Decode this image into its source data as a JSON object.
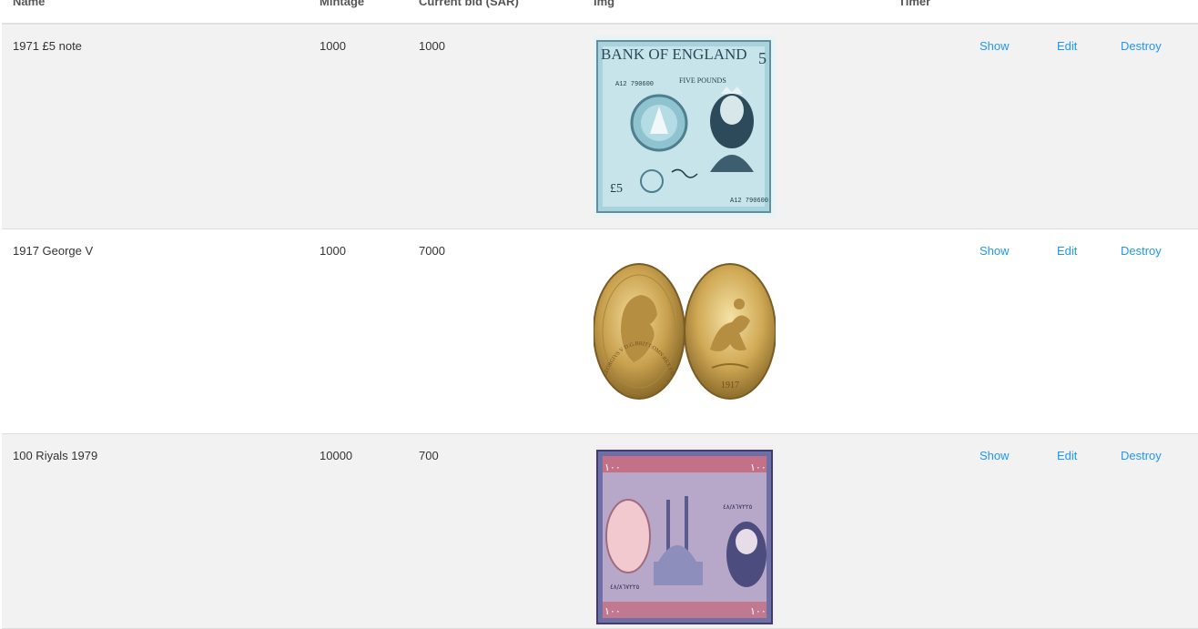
{
  "columns": {
    "name": "Name",
    "mintage": "Mintage",
    "current_bid": "Current bid (SAR)",
    "img": "Img",
    "timer": "Timer"
  },
  "rows": [
    {
      "name": "1971 £5 note",
      "mintage": "1000",
      "current_bid": "1000",
      "img_subject": "five-pound-banknote-image",
      "img_text": {
        "bank": "BANK OF ENGLAND",
        "serial": "A12 790600",
        "denom": "FIVE POUNDS",
        "symbol": "£5",
        "corner": "5"
      },
      "show": "Show",
      "edit": "Edit",
      "destroy": "Destroy"
    },
    {
      "name": "1917 George V",
      "mintage": "1000",
      "current_bid": "7000",
      "img_subject": "gold-sovereign-coin-image",
      "img_text": {
        "legend": "GEORGIVS V D.G.BRITT:OMN:REX F.D.IND:IMP:",
        "year": "1917"
      },
      "show": "Show",
      "edit": "Edit",
      "destroy": "Destroy"
    },
    {
      "name": "100 Riyals 1979",
      "mintage": "10000",
      "current_bid": "700",
      "img_subject": "hundred-riyal-banknote-image",
      "img_text": {
        "corner": "١٠٠",
        "serial": "٤٨/٨٦٧٢٢٥"
      },
      "show": "Show",
      "edit": "Edit",
      "destroy": "Destroy"
    }
  ],
  "colors": {
    "link": "#2196f3",
    "row_shaded": "#f2f2f2",
    "row_plain": "#ffffff",
    "text": "#333333"
  }
}
